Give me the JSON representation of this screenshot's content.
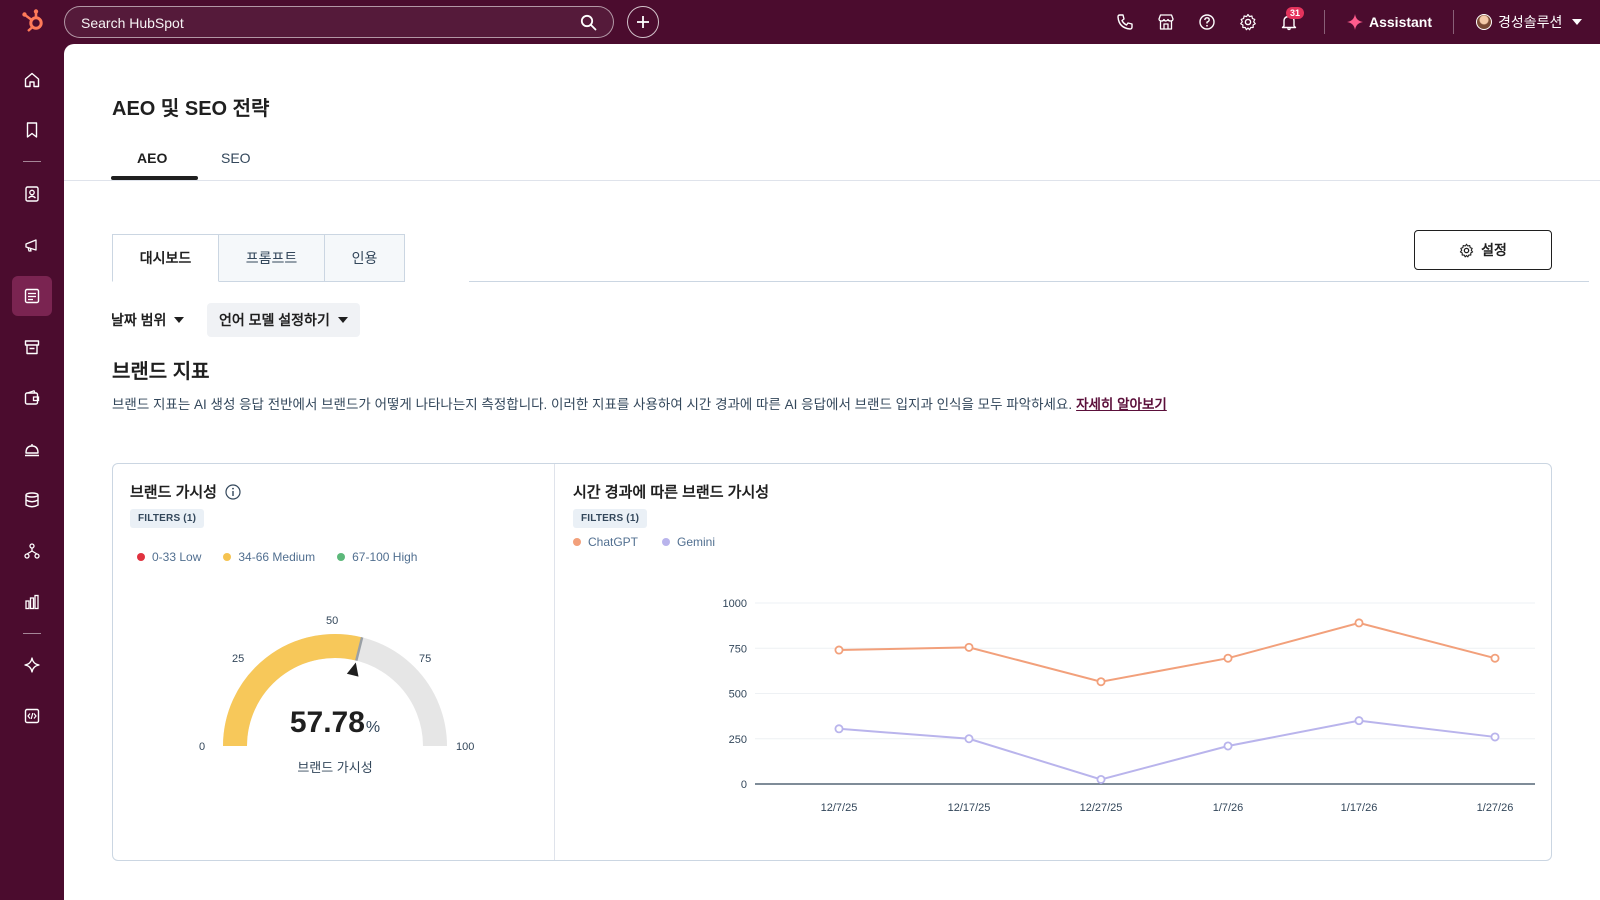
{
  "topbar": {
    "search_placeholder": "Search HubSpot",
    "notification_count": "31",
    "assistant_label": "Assistant",
    "account_name": "경성솔루션"
  },
  "page": {
    "title": "AEO 및 SEO 전략",
    "tabs": [
      {
        "label": "AEO",
        "active": true
      },
      {
        "label": "SEO",
        "active": false
      }
    ],
    "subtabs": [
      {
        "label": "대시보드",
        "active": true
      },
      {
        "label": "프롬프트",
        "active": false
      },
      {
        "label": "인용",
        "active": false
      }
    ],
    "settings_label": "설정",
    "filters": {
      "date_range": "날짜 범위",
      "language_model": "언어 모델 설정하기"
    },
    "section": {
      "title": "브랜드 지표",
      "description": "브랜드 지표는 AI 생성 응답 전반에서 브랜드가 어떻게 나타나는지 측정합니다. 이러한 지표를 사용하여 시간 경과에 따른 AI 응답에서 브랜드 입지과 인식을 모두 파악하세요.",
      "learn_more": "자세히 알아보기"
    }
  },
  "brand_visibility": {
    "title": "브랜드 가시성",
    "filter_pill": "FILTERS (1)",
    "legend": [
      {
        "label": "0-33 Low",
        "color": "#e0323f"
      },
      {
        "label": "34-66 Medium",
        "color": "#f5c350"
      },
      {
        "label": "67-100 High",
        "color": "#5cb87a"
      }
    ],
    "gauge_ticks": {
      "t0": "0",
      "t25": "25",
      "t50": "50",
      "t75": "75",
      "t100": "100"
    },
    "value": 57.78,
    "value_text": "57.78",
    "unit": "%",
    "value_label": "브랜드 가시성",
    "fill_color": "#f7c85a",
    "track_color": "#e6e6e6"
  },
  "chart_data": {
    "type": "line",
    "title": "시간 경과에 따른 브랜드 가시성",
    "filter_pill": "FILTERS (1)",
    "categories": [
      "12/7/25",
      "12/17/25",
      "12/27/25",
      "1/7/26",
      "1/17/26",
      "1/27/26"
    ],
    "series": [
      {
        "name": "ChatGPT",
        "color": "#f2a07b",
        "values": [
          740,
          755,
          565,
          695,
          890,
          695
        ]
      },
      {
        "name": "Gemini",
        "color": "#b9b4ec",
        "values": [
          305,
          250,
          25,
          210,
          350,
          260
        ]
      }
    ],
    "ylim": [
      0,
      1000
    ],
    "yticks": [
      "0",
      "250",
      "500",
      "750",
      "1000"
    ],
    "grid": true,
    "legend_position": "top-left"
  }
}
